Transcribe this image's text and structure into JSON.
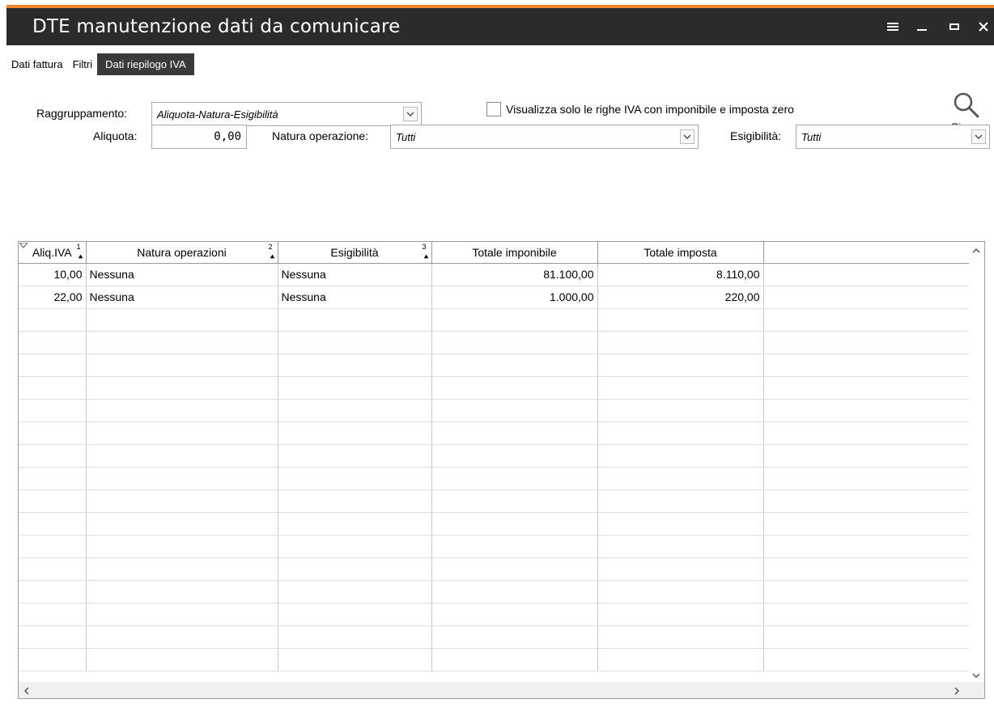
{
  "window": {
    "title": "DTE manutenzione dati da comunicare",
    "accent_color": "#f0862d",
    "buttons": [
      "menu-icon",
      "minimize-icon",
      "maximize-icon",
      "close-icon"
    ]
  },
  "tabs": [
    {
      "label": "Dati fattura",
      "active": false
    },
    {
      "label": "Filtri",
      "active": false
    },
    {
      "label": "Dati riepilogo IVA",
      "active": true
    }
  ],
  "filters": {
    "raggruppamento_label": "Raggruppamento:",
    "raggruppamento_value": "Aliquota-Natura-Esigibilità",
    "checkbox_label": "Visualizza solo le righe IVA con imponibile e imposta zero",
    "checkbox_checked": false,
    "search_label_first": "R",
    "search_label_rest": "icerca",
    "aliquota_label": "Aliquota:",
    "aliquota_value": "0,00",
    "natura_label": "Natura operazione:",
    "natura_value": "Tutti",
    "esigibilita_label": "Esigibilità:",
    "esigibilita_value": "Tutti"
  },
  "grid": {
    "columns": [
      {
        "label": "Aliq.IVA",
        "sort": "1"
      },
      {
        "label": "Natura operazioni",
        "sort": "2"
      },
      {
        "label": "Esigibilità",
        "sort": "3"
      },
      {
        "label": "Totale imponibile",
        "sort": ""
      },
      {
        "label": "Totale imposta",
        "sort": ""
      }
    ],
    "rows": [
      [
        "10,00",
        "Nessuna",
        "Nessuna",
        "81.100,00",
        "8.110,00"
      ],
      [
        "22,00",
        "Nessuna",
        "Nessuna",
        "1.000,00",
        "220,00"
      ]
    ]
  }
}
